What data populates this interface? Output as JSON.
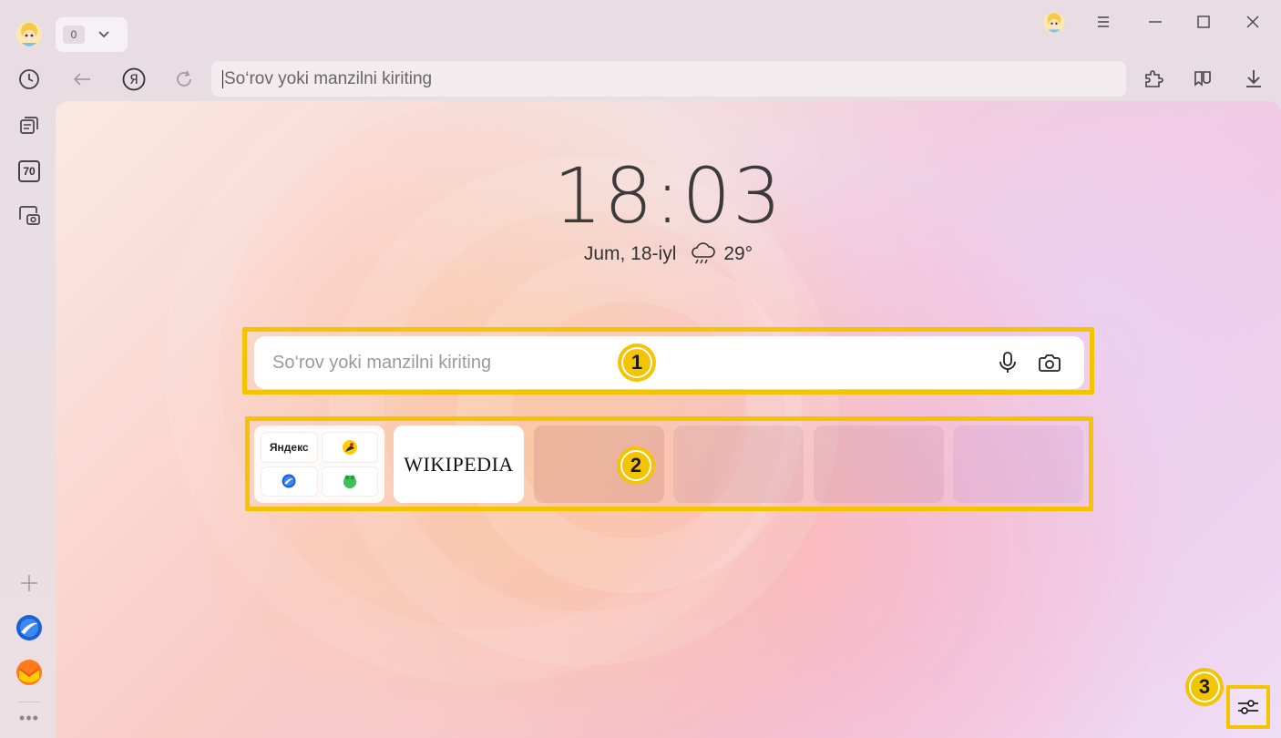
{
  "tabs": {
    "count": "0"
  },
  "address_bar": {
    "placeholder": "So‘rov yoki manzilni kiriting"
  },
  "sidebar": {
    "badge_70": "70",
    "more": "•••"
  },
  "newtab": {
    "clock": "18:03",
    "date": "Jum, 18-iyl",
    "weather": {
      "temperature": "29°",
      "icon": "rain-cloud-icon"
    },
    "search_placeholder": "So‘rov yoki manzilni kiriting",
    "tiles": [
      {
        "type": "group",
        "items": [
          "Яндекс",
          "maps",
          "browser",
          "music"
        ]
      },
      {
        "type": "site",
        "label": "WIKIPEDIA"
      },
      {
        "type": "empty"
      },
      {
        "type": "empty"
      },
      {
        "type": "empty"
      },
      {
        "type": "empty"
      }
    ],
    "badges": [
      "1",
      "2",
      "3"
    ]
  },
  "colors": {
    "highlight": "#f5c400",
    "accent_red": "#e0281e"
  }
}
